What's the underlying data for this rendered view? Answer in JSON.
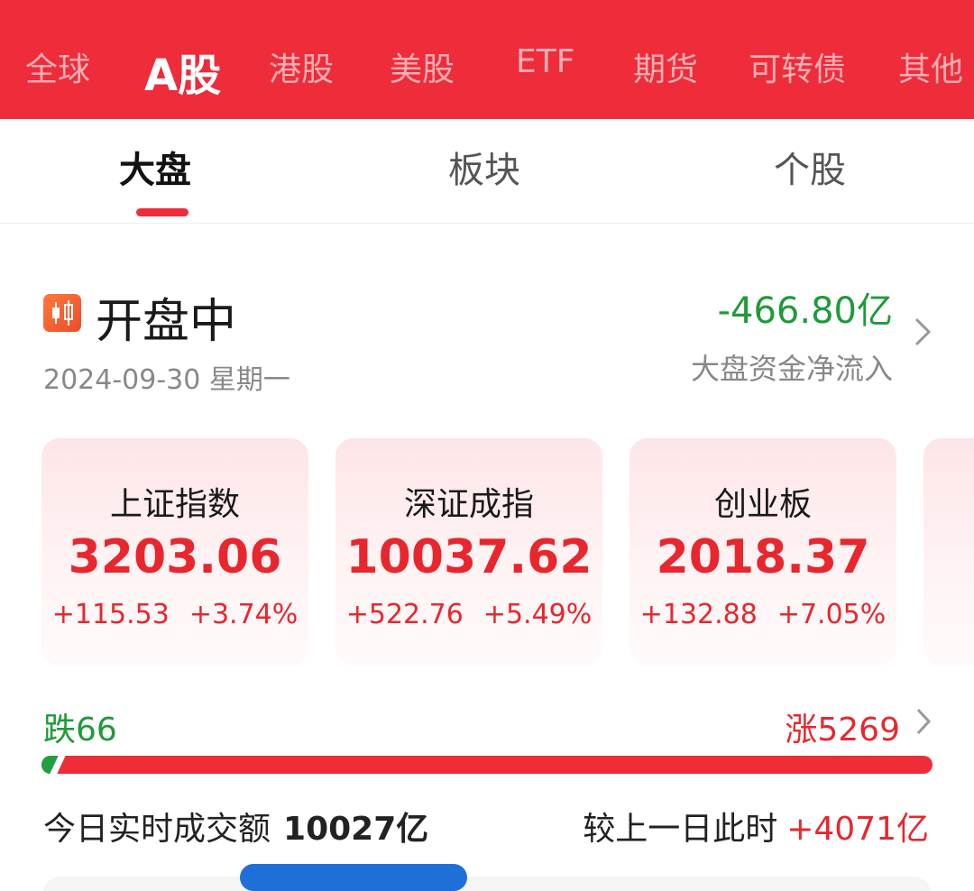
{
  "market_tabs": [
    "全球",
    "A股",
    "港股",
    "美股",
    "ETF",
    "期货",
    "可转债",
    "其他"
  ],
  "market_active": "A股",
  "sub_tabs": [
    "大盘",
    "板块",
    "个股"
  ],
  "sub_active": "大盘",
  "status": {
    "title": "开盘中",
    "date": "2024-09-30 星期一",
    "icon": "candlestick-icon"
  },
  "fund_flow": {
    "value": "-466.80亿",
    "label": "大盘资金净流入"
  },
  "indices": [
    {
      "name": "上证指数",
      "price": "3203.06",
      "change": "+115.53",
      "change_pct": "+3.74%"
    },
    {
      "name": "深证成指",
      "price": "10037.62",
      "change": "+522.76",
      "change_pct": "+5.49%"
    },
    {
      "name": "创业板",
      "price": "2018.37",
      "change": "+132.88",
      "change_pct": "+7.05%"
    }
  ],
  "breadth": {
    "fall_label": "跌66",
    "rise_label": "涨5269",
    "fall_count": 66,
    "rise_count": 5269
  },
  "turnover": {
    "label": "今日实时成交额",
    "value": "10027亿",
    "compare_label": "较上一日此时",
    "compare_value": "+4071亿"
  },
  "colors": {
    "brand_red": "#ee2c3a",
    "up_red": "#e8262e",
    "down_green": "#1f9a3a"
  }
}
